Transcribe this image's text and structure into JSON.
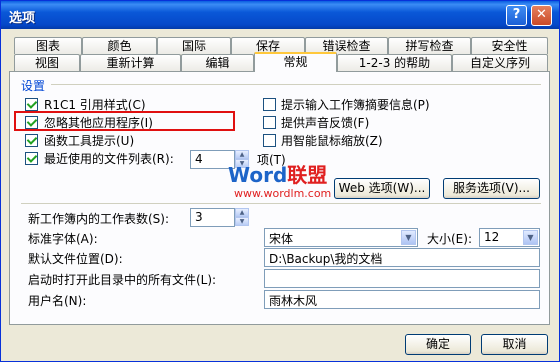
{
  "window": {
    "title": "选项"
  },
  "tabs_row1": [
    "图表",
    "颜色",
    "国际",
    "保存",
    "错误检查",
    "拼写检查",
    "安全性"
  ],
  "tabs_row2": [
    "视图",
    "重新计算",
    "编辑",
    "常规",
    "1-2-3 的帮助",
    "自定义序列"
  ],
  "active_tab": "常规",
  "settings": {
    "group_label": "设置",
    "left": [
      {
        "label": "R1C1 引用样式(C)",
        "checked": true
      },
      {
        "label": "忽略其他应用程序(I)",
        "checked": true
      },
      {
        "label": "函数工具提示(U)",
        "checked": true
      },
      {
        "label": "最近使用的文件列表(R):",
        "checked": true
      }
    ],
    "right": [
      {
        "label": "提示输入工作簿摘要信息(P)",
        "checked": false
      },
      {
        "label": "提供声音反馈(F)",
        "checked": false
      },
      {
        "label": "用智能鼠标缩放(Z)",
        "checked": false
      }
    ],
    "recent_count": "4",
    "recent_suffix": "项(T)",
    "web_options_button": "Web 选项(W)...",
    "service_options_button": "服务选项(V)..."
  },
  "workbook": {
    "sheets_label": "新工作簿内的工作表数(S):",
    "sheets_value": "3",
    "std_font_label": "标准字体(A):",
    "std_font_value": "宋体",
    "size_label": "大小(E):",
    "size_value": "12",
    "default_path_label": "默认文件位置(D):",
    "default_path_value": "D:\\Backup\\我的文档",
    "startup_label": "启动时打开此目录中的所有文件(L):",
    "startup_value": "",
    "username_label": "用户名(N):",
    "username_value": "雨林木风"
  },
  "watermark": {
    "brand_a": "Word",
    "brand_b": "联盟",
    "url": "www.wordlm.com"
  },
  "footer": {
    "ok": "确定",
    "cancel": "取消"
  }
}
